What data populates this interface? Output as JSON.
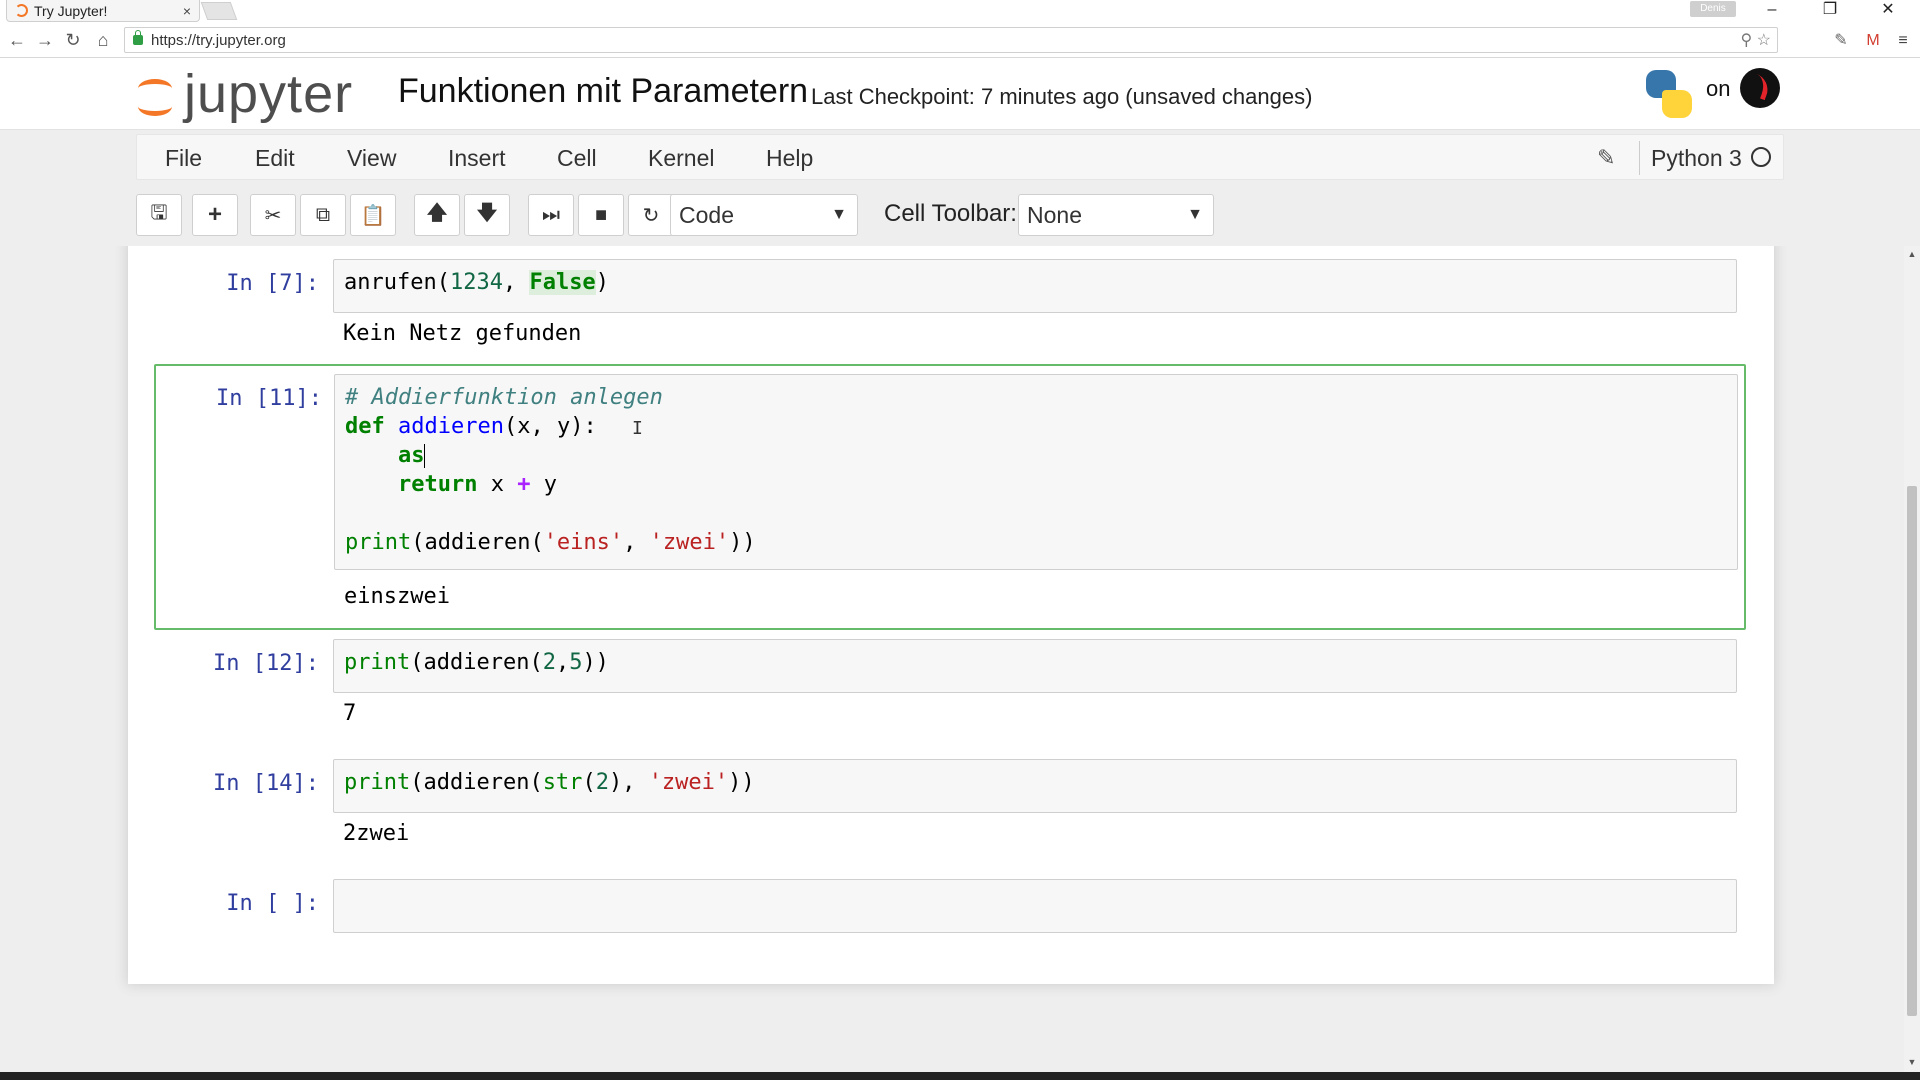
{
  "browser": {
    "tab_title": "Try Jupyter!",
    "tab_close": "×",
    "user_badge": "Denis",
    "url": "https://try.jupyter.org"
  },
  "header": {
    "logo_text": "jupyter",
    "notebook_title": "Funktionen mit Parametern",
    "checkpoint": "Last Checkpoint: 7 minutes ago (unsaved changes)",
    "on_text": "on"
  },
  "menu": {
    "items": [
      "File",
      "Edit",
      "View",
      "Insert",
      "Cell",
      "Kernel",
      "Help"
    ],
    "kernel": "Python 3"
  },
  "toolbar": {
    "cell_type": "Code",
    "cell_toolbar_label": "Cell Toolbar:",
    "cell_toolbar_value": "None"
  },
  "cells": [
    {
      "prompt": "In [7]:",
      "output": "Kein Netz gefunden"
    },
    {
      "prompt": "In [11]:",
      "output": "einszwei"
    },
    {
      "prompt": "In [12]:",
      "output": "7"
    },
    {
      "prompt": "In [14]:",
      "output": "2zwei"
    },
    {
      "prompt": "In [ ]:"
    }
  ],
  "colors": {
    "jupyter_orange": "#f37726",
    "prompt_blue": "#303f9f",
    "selected_border": "#66bb6a"
  }
}
